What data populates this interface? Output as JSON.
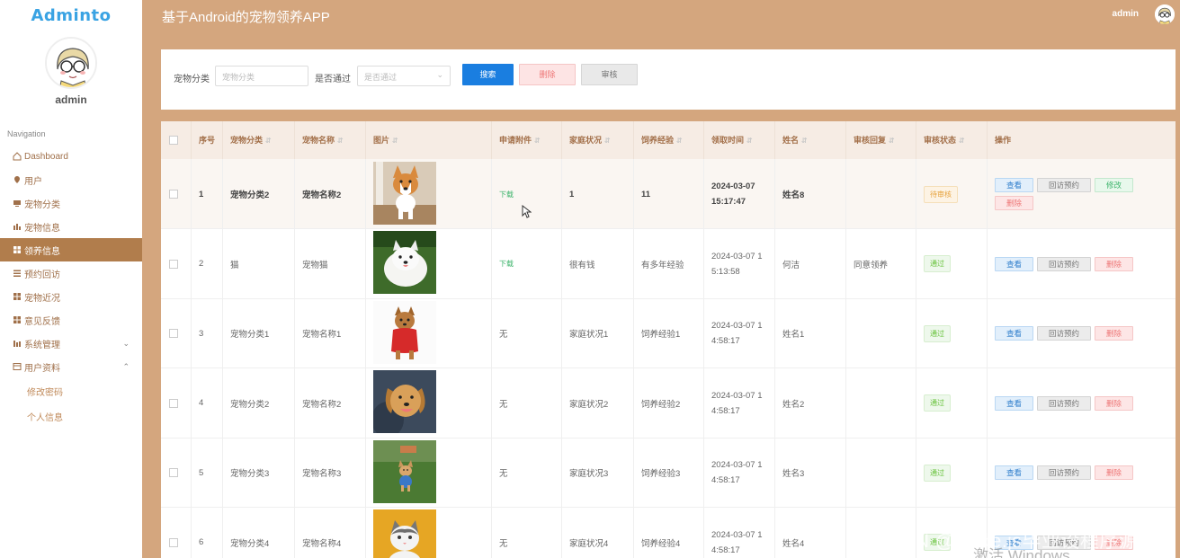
{
  "sidebar": {
    "logo": "Adminto",
    "username": "admin",
    "nav_title": "Navigation",
    "items": [
      {
        "label": "Dashboard",
        "icon": "home-icon"
      },
      {
        "label": "用户",
        "icon": "user-pin-icon"
      },
      {
        "label": "宠物分类",
        "icon": "category-icon"
      },
      {
        "label": "宠物信息",
        "icon": "bar-chart-icon"
      },
      {
        "label": "领养信息",
        "icon": "grid-icon",
        "active": true
      },
      {
        "label": "预约回访",
        "icon": "list-icon"
      },
      {
        "label": "宠物近况",
        "icon": "grid-icon"
      },
      {
        "label": "意见反馈",
        "icon": "grid-icon"
      },
      {
        "label": "系统管理",
        "icon": "bar-chart-icon"
      },
      {
        "label": "用户资料",
        "icon": "profile-icon"
      }
    ],
    "subitems": [
      {
        "label": "修改密码"
      },
      {
        "label": "个人信息"
      }
    ]
  },
  "header": {
    "title": "基于Android的宠物领养APP",
    "user": "admin"
  },
  "search": {
    "category_label": "宠物分类",
    "category_placeholder": "宠物分类",
    "approved_label": "是否通过",
    "approved_placeholder": "是否通过",
    "search_button": "搜索",
    "delete_button": "删除",
    "audit_button": "审核"
  },
  "table": {
    "headers": [
      "序号",
      "宠物分类",
      "宠物名称",
      "图片",
      "申请附件",
      "家庭状况",
      "饲养经验",
      "领取时间",
      "姓名",
      "审核回复",
      "审核状态",
      "操作"
    ],
    "rows": [
      {
        "no": "1",
        "category": "宠物分类2",
        "name": "宠物名称2",
        "attachment": "下载",
        "family": "1",
        "experience": "11",
        "time1": "2024-03-07",
        "time2": "15:17:47",
        "person": "姓名8",
        "reply": "",
        "status": "待审核",
        "status_type": "pending",
        "pic": "corgi"
      },
      {
        "no": "2",
        "category": "猫",
        "name": "宠物猫",
        "attachment": "下载",
        "family": "很有钱",
        "experience": "有多年经验",
        "time1": "2024-03-07 1",
        "time2": "5:13:58",
        "person": "何洁",
        "reply": "同意领养",
        "status": "通过",
        "status_type": "pass",
        "pic": "samoyed"
      },
      {
        "no": "3",
        "category": "宠物分类1",
        "name": "宠物名称1",
        "attachment": "无",
        "family": "家庭状况1",
        "experience": "饲养经验1",
        "time1": "2024-03-07 1",
        "time2": "4:58:17",
        "person": "姓名1",
        "reply": "",
        "status": "通过",
        "status_type": "pass",
        "pic": "yorkie"
      },
      {
        "no": "4",
        "category": "宠物分类2",
        "name": "宠物名称2",
        "attachment": "无",
        "family": "家庭状况2",
        "experience": "饲养经验2",
        "time1": "2024-03-07 1",
        "time2": "4:58:17",
        "person": "姓名2",
        "reply": "",
        "status": "通过",
        "status_type": "pass",
        "pic": "golden"
      },
      {
        "no": "5",
        "category": "宠物分类3",
        "name": "宠物名称3",
        "attachment": "无",
        "family": "家庭状况3",
        "experience": "饲养经验3",
        "time1": "2024-03-07 1",
        "time2": "4:58:17",
        "person": "姓名3",
        "reply": "",
        "status": "通过",
        "status_type": "pass",
        "pic": "small-dog"
      },
      {
        "no": "6",
        "category": "宠物分类4",
        "name": "宠物名称4",
        "attachment": "无",
        "family": "家庭状况4",
        "experience": "饲养经验4",
        "time1": "2024-03-07 1",
        "time2": "4:58:17",
        "person": "姓名4",
        "reply": "",
        "status": "通过",
        "status_type": "pass",
        "pic": "cat"
      }
    ],
    "actions": {
      "view": "查看",
      "visit": "回访预约",
      "edit": "修改",
      "delete": "删除"
    }
  },
  "watermark": {
    "csdn": "CSDN @Node.js毕业设程序源码",
    "windows": "激活 Windows"
  },
  "colors": {
    "accent": "#b17d4c",
    "header_bg": "#d4a67e",
    "primary": "#1a7ee0"
  }
}
